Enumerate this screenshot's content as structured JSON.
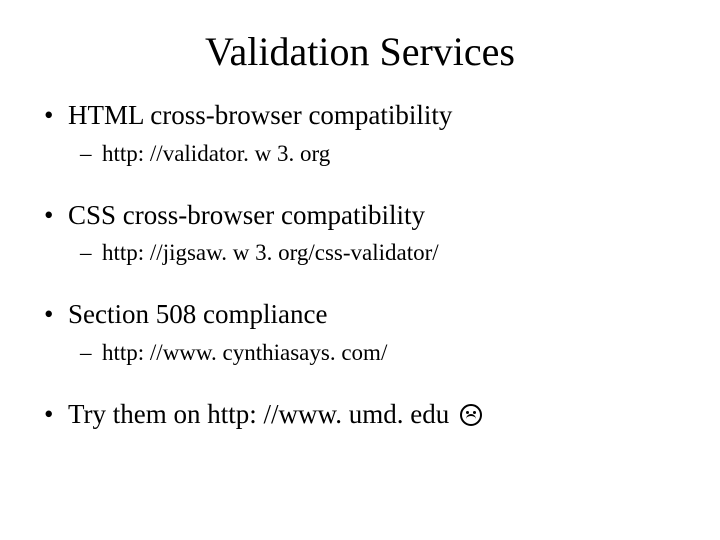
{
  "title": "Validation Services",
  "bullets": [
    {
      "text": "HTML cross-browser compatibility",
      "sub": [
        "http: //validator. w 3. org"
      ]
    },
    {
      "text": "CSS cross-browser compatibility",
      "sub": [
        "http: //jigsaw. w 3. org/css-validator/"
      ]
    },
    {
      "text": "Section 508 compliance",
      "sub": [
        "http: //www. cynthiasays. com/"
      ]
    },
    {
      "text": "Try them on http: //www. umd. edu ",
      "sad": true
    }
  ]
}
